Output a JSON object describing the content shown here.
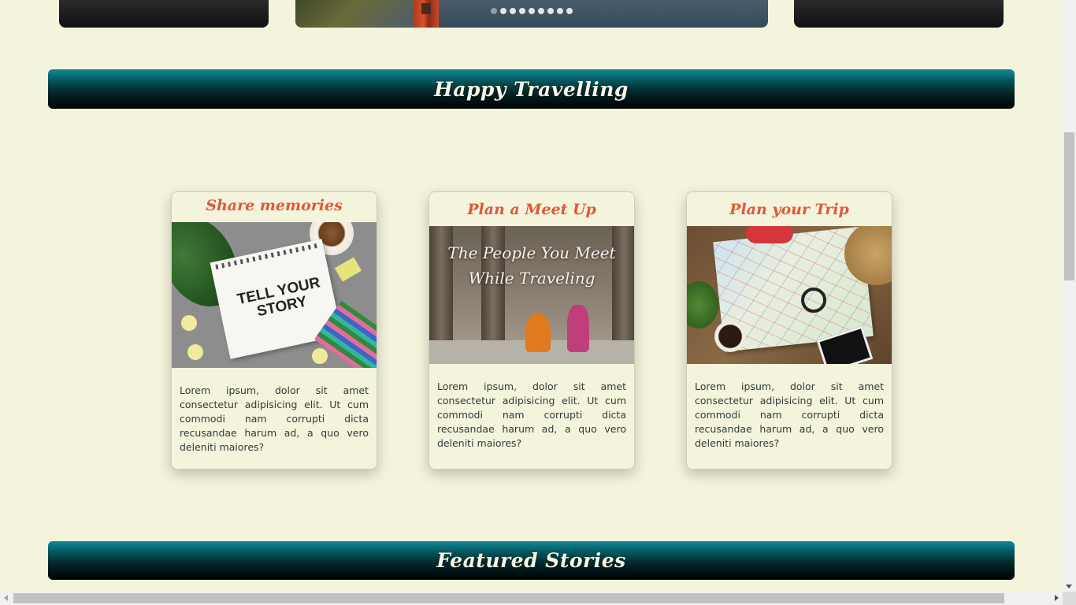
{
  "carousel": {
    "dot_count": 9,
    "active_dot": 0
  },
  "sections": {
    "happy_travelling": "Happy Travelling",
    "featured_stories": "Featured Stories"
  },
  "cards": [
    {
      "title": "Share memories",
      "image_text": "TELL YOUR STORY",
      "body": "Lorem ipsum, dolor sit amet consectetur adipisicing elit. Ut cum commodi nam corrupti dicta recusandae harum ad, a quo vero deleniti maiores?"
    },
    {
      "title": "Plan a Meet Up",
      "image_text_line1": "The People You Meet",
      "image_text_line2": "While Traveling",
      "body": "Lorem ipsum, dolor sit amet consectetur adipisicing elit. Ut cum commodi nam corrupti dicta recusandae harum ad, a quo vero deleniti maiores?"
    },
    {
      "title": "Plan your Trip",
      "body": "Lorem ipsum, dolor sit amet consectetur adipisicing elit. Ut cum commodi nam corrupti dicta recusandae harum ad, a quo vero deleniti maiores?"
    }
  ],
  "colors": {
    "background": "#f4f3dc",
    "card_title": "#e0583a",
    "banner_top": "#0e8a95",
    "banner_bottom": "#000000",
    "banner_text": "#fbf6e6"
  },
  "icons": {
    "carousel_indicator": "dot-icon",
    "scroll_up": "chevron-up-icon",
    "scroll_down": "chevron-down-icon",
    "scroll_left": "chevron-left-icon",
    "scroll_right": "chevron-right-icon"
  }
}
